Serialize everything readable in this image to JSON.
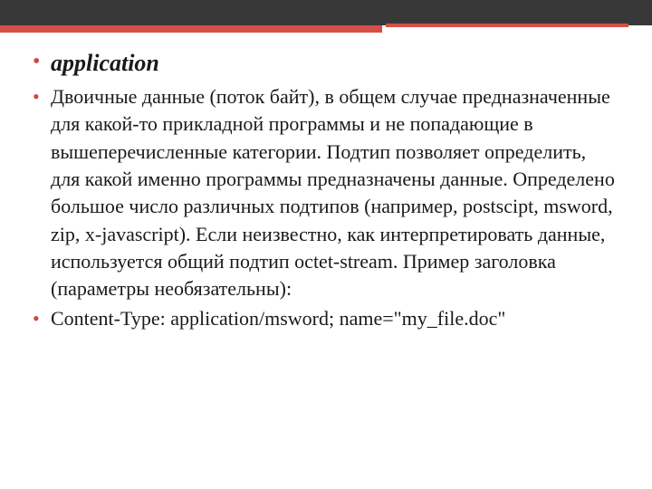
{
  "slide": {
    "heading": "application",
    "paragraph": "Двоичные данные (поток байт), в общем случае предназначенные для какой-то прикладной программы и не попадающие в вышеперечисленные категории. Подтип позволяет определить, для какой именно программы предназначены данные. Определено большое число различных подтипов (например, postscipt, msword, zip, x-javascript). Если неизвестно, как интерпретировать данные, используется общий подтип octet-stream. Пример заголовка (параметры необязательны):",
    "example": "Content-Type: application/msword; name=\"my_file.doc\""
  }
}
